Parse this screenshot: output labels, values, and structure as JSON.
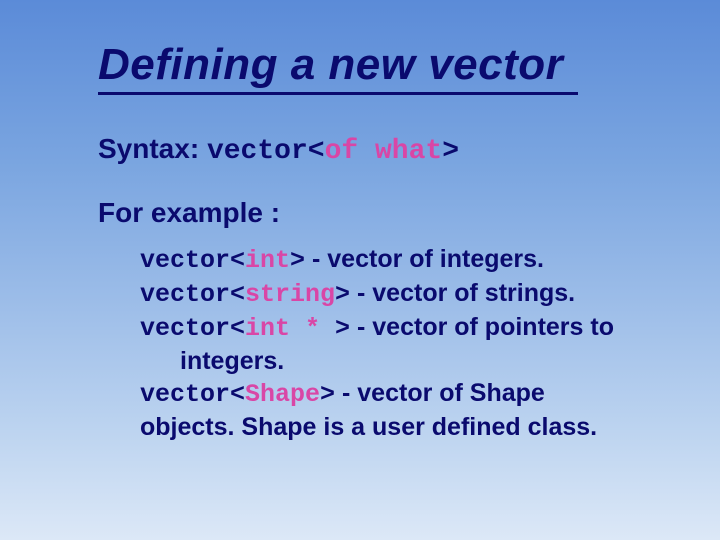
{
  "title": "Defining a new vector",
  "syntax": {
    "label": "Syntax:",
    "code_prefix": "vector<",
    "code_inner": "of what",
    "code_suffix": ">"
  },
  "for_example_label": "For example :",
  "examples": {
    "e1": {
      "prefix": "vector<",
      "type": "int",
      "suffix": ">",
      "desc": " - vector of integers."
    },
    "e2": {
      "prefix": "vector<",
      "type": "string",
      "suffix": ">",
      "desc": " - vector of strings."
    },
    "e3": {
      "prefix": "vector<",
      "type": "int *",
      "suffix": " >",
      "desc": " - vector of pointers to",
      "cont": "integers."
    },
    "e4": {
      "prefix": "vector<",
      "type": "Shape",
      "suffix": ">",
      "desc": " - vector of Shape",
      "cont": "objects. Shape is a user defined class."
    }
  }
}
